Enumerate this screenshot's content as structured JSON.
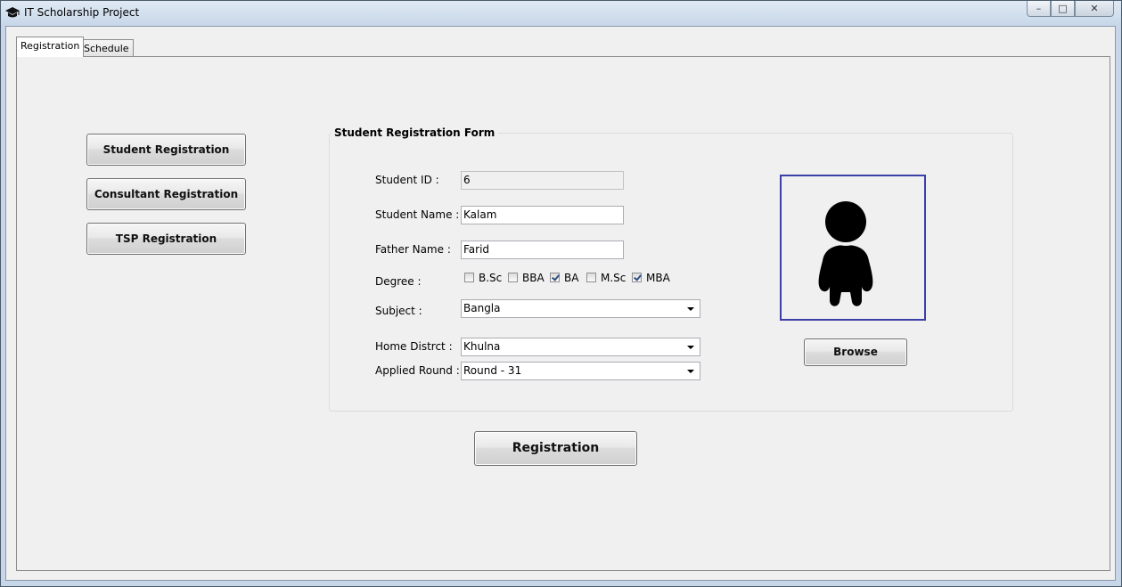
{
  "window": {
    "title": "IT Scholarship Project",
    "controls": {
      "minimize": "–",
      "maximize": "□",
      "close": "✕"
    }
  },
  "tabs": [
    {
      "label": "Registration",
      "active": true
    },
    {
      "label": "Schedule",
      "active": false
    }
  ],
  "sidebar": {
    "buttons": [
      {
        "label": "Student Registration"
      },
      {
        "label": "Consultant Registration"
      },
      {
        "label": "TSP Registration"
      }
    ]
  },
  "form": {
    "title": "Student Registration Form",
    "student_id": {
      "label": "Student ID :",
      "value": "6"
    },
    "student_name": {
      "label": "Student Name :",
      "value": "Kalam"
    },
    "father_name": {
      "label": "Father Name :",
      "value": "Farid"
    },
    "degree": {
      "label": "Degree :",
      "options": [
        {
          "label": "B.Sc",
          "checked": false
        },
        {
          "label": "BBA",
          "checked": false
        },
        {
          "label": "BA",
          "checked": true
        },
        {
          "label": "M.Sc",
          "checked": false
        },
        {
          "label": "MBA",
          "checked": true
        }
      ]
    },
    "subject": {
      "label": "Subject :",
      "value": "Bangla"
    },
    "home_district": {
      "label": "Home Distrct :",
      "value": "Khulna"
    },
    "applied_round": {
      "label": "Applied Round :",
      "value": "Round - 31"
    },
    "photo": {
      "icon": "person-silhouette-icon"
    },
    "browse_label": "Browse"
  },
  "submit_label": "Registration",
  "colors": {
    "photo_border": "#3b3fa8",
    "client_background": "#f0f0f0",
    "check_mark": "#2d4e7e"
  }
}
